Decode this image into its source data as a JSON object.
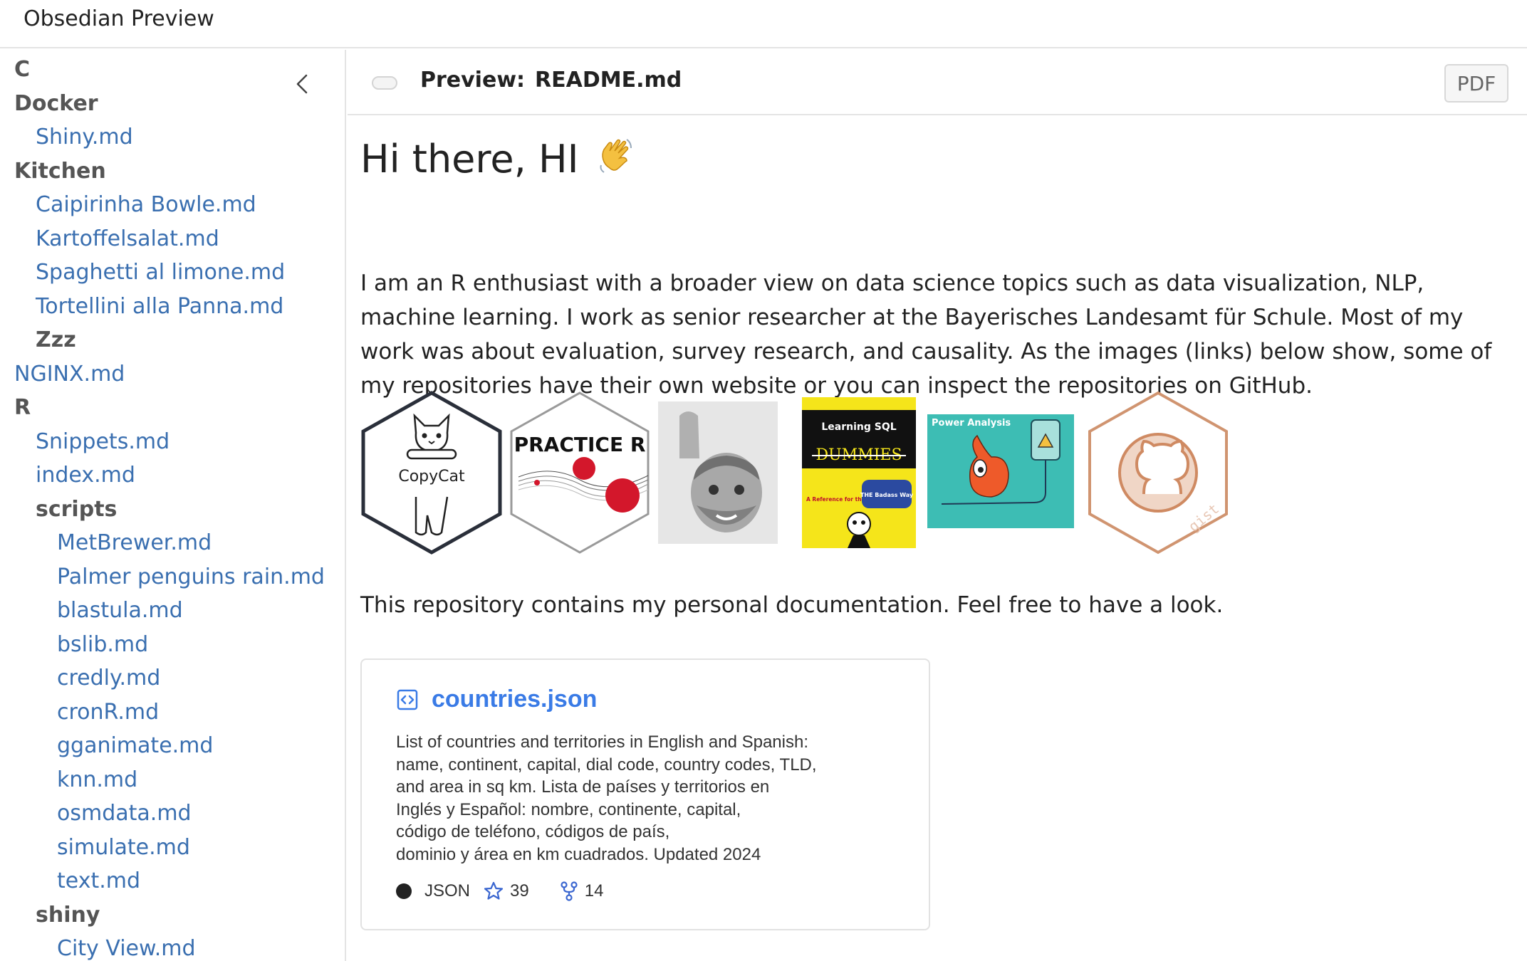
{
  "app": {
    "title": "Obsedian Preview"
  },
  "sidebar": {
    "collapse_icon": "chevron-left-icon",
    "tree": [
      {
        "label": "C",
        "type": "folder",
        "depth": 0
      },
      {
        "label": "Docker",
        "type": "folder",
        "depth": 0
      },
      {
        "label": "Shiny.md",
        "type": "file",
        "depth": 1
      },
      {
        "label": "Kitchen",
        "type": "folder",
        "depth": 0
      },
      {
        "label": "Caipirinha Bowle.md",
        "type": "file",
        "depth": 1
      },
      {
        "label": "Kartoffelsalat.md",
        "type": "file",
        "depth": 1
      },
      {
        "label": "Spaghetti al limone.md",
        "type": "file",
        "depth": 1
      },
      {
        "label": "Tortellini alla Panna.md",
        "type": "file",
        "depth": 1
      },
      {
        "label": "Zzz",
        "type": "folder",
        "depth": 1
      },
      {
        "label": "NGINX.md",
        "type": "file",
        "depth": 0
      },
      {
        "label": "R",
        "type": "folder",
        "depth": 0
      },
      {
        "label": "Snippets.md",
        "type": "file",
        "depth": 1
      },
      {
        "label": "index.md",
        "type": "file",
        "depth": 1
      },
      {
        "label": "scripts",
        "type": "folder",
        "depth": 1
      },
      {
        "label": "MetBrewer.md",
        "type": "file",
        "depth": 2
      },
      {
        "label": "Palmer penguins rain.md",
        "type": "file",
        "depth": 2
      },
      {
        "label": "blastula.md",
        "type": "file",
        "depth": 2
      },
      {
        "label": "bslib.md",
        "type": "file",
        "depth": 2
      },
      {
        "label": "credly.md",
        "type": "file",
        "depth": 2
      },
      {
        "label": "cronR.md",
        "type": "file",
        "depth": 2
      },
      {
        "label": "gganimate.md",
        "type": "file",
        "depth": 2
      },
      {
        "label": "knn.md",
        "type": "file",
        "depth": 2
      },
      {
        "label": "osmdata.md",
        "type": "file",
        "depth": 2
      },
      {
        "label": "simulate.md",
        "type": "file",
        "depth": 2
      },
      {
        "label": "text.md",
        "type": "file",
        "depth": 2
      },
      {
        "label": "shiny",
        "type": "folder",
        "depth": 1
      },
      {
        "label": "City View.md",
        "type": "file",
        "depth": 2
      }
    ]
  },
  "toolbar": {
    "preview_prefix": "Preview:",
    "filename": "README.md",
    "pdf_label": "PDF"
  },
  "doc": {
    "heading": "Hi there, HI",
    "heading_emoji": "waving-hand-icon",
    "intro": "I am an R enthusiast with a broader view on data science topics such as data visualization, NLP, machine learning. I work as senior researcher at the Bayerisches Landesamt für Schule. Most of my work was about evaluation, survey research, and causality. As the images (links) below show, some of my repositories have their own website or you can inspect the repositories on GitHub.",
    "outro": "This repository contains my personal documentation. Feel free to have a look.",
    "badges": {
      "copycat": "CopyCat",
      "practice_r": "PRACTICE R",
      "book_title": "Learning SQL",
      "book_dummies": "DUMMIES",
      "book_reference": "A Reference for the Rest of Us!",
      "book_badass": "THE Badass Way",
      "power_analysis": "Power Analysis",
      "gist": "gist"
    }
  },
  "card": {
    "icon": "code-square-icon",
    "title": "countries.json",
    "description": "List of countries and territories in English and Spanish:\nname, continent, capital, dial code, country codes, TLD,\nand area in sq km. Lista de países y territorios en\nInglés y Español: nombre, continente, capital,\ncódigo de teléfono, códigos de país,\ndominio y área en km cuadrados. Updated 2024",
    "language": "JSON",
    "language_color": "#222222",
    "stars": "39",
    "forks": "14",
    "accent": "#3a7be6"
  }
}
